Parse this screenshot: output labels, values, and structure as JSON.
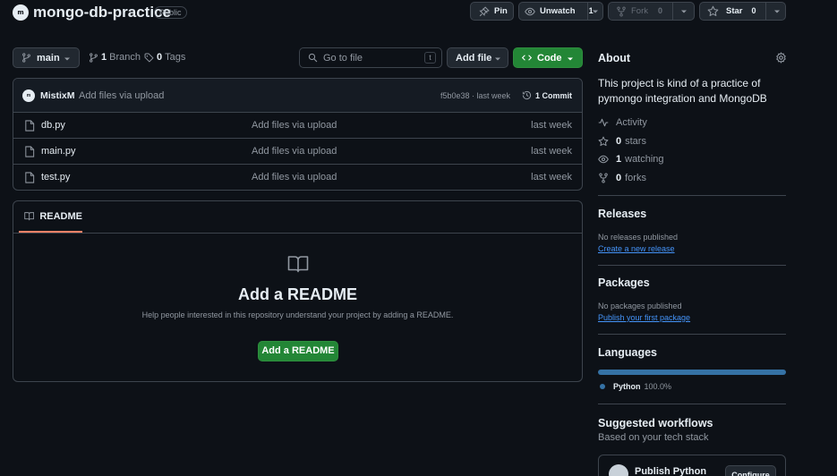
{
  "repo": {
    "owner_initials": "m",
    "name": "mongo-db-practice",
    "visibility": "Public"
  },
  "actions": {
    "pin_label": "Pin",
    "unwatch_label": "Unwatch",
    "watch_count": "1",
    "fork_label": "Fork",
    "fork_count": "0",
    "star_label": "Star",
    "star_count": "0"
  },
  "toolbar": {
    "branch": "main",
    "branch_count": "1",
    "branch_label": "Branch",
    "tag_count": "0",
    "tag_label": "Tags",
    "search_placeholder": "Go to file",
    "search_kbd": "t",
    "add_file_label": "Add file",
    "code_label": "Code"
  },
  "latest_commit": {
    "author": "MistixM",
    "author_initials": "m",
    "message": "Add files via upload",
    "hash_time": "f5b0e38 · last week",
    "commit_count": "1 Commit"
  },
  "files": [
    {
      "name": "db.py",
      "message": "Add files via upload",
      "time": "last week"
    },
    {
      "name": "main.py",
      "message": "Add files via upload",
      "time": "last week"
    },
    {
      "name": "test.py",
      "message": "Add files via upload",
      "time": "last week"
    }
  ],
  "readme": {
    "tab_label": "README",
    "title": "Add a README",
    "subtitle": "Help people interested in this repository understand your project by adding a README.",
    "button_label": "Add a README"
  },
  "about": {
    "heading": "About",
    "description": "This project is kind of a practice of pymongo integration and MongoDB",
    "activity_label": "Activity",
    "stars_count": "0",
    "stars_label": "stars",
    "watching_count": "1",
    "watching_label": "watching",
    "forks_count": "0",
    "forks_label": "forks"
  },
  "releases": {
    "heading": "Releases",
    "empty_text": "No releases published",
    "link": "Create a new release"
  },
  "packages": {
    "heading": "Packages",
    "empty_text": "No packages published",
    "link": "Publish your first package"
  },
  "languages": {
    "heading": "Languages",
    "items": [
      {
        "name": "Python",
        "percent": "100.0%",
        "color": "#3572a5"
      }
    ]
  },
  "workflows": {
    "heading": "Suggested workflows",
    "subheading": "Based on your tech stack",
    "card_title": "Publish Python",
    "card_button": "Configure"
  },
  "colors": {
    "background": "#0d1117",
    "border": "#3d444d",
    "primary_green": "#238636",
    "link_blue": "#4493f8",
    "readme_tab_accent": "#f78166"
  }
}
